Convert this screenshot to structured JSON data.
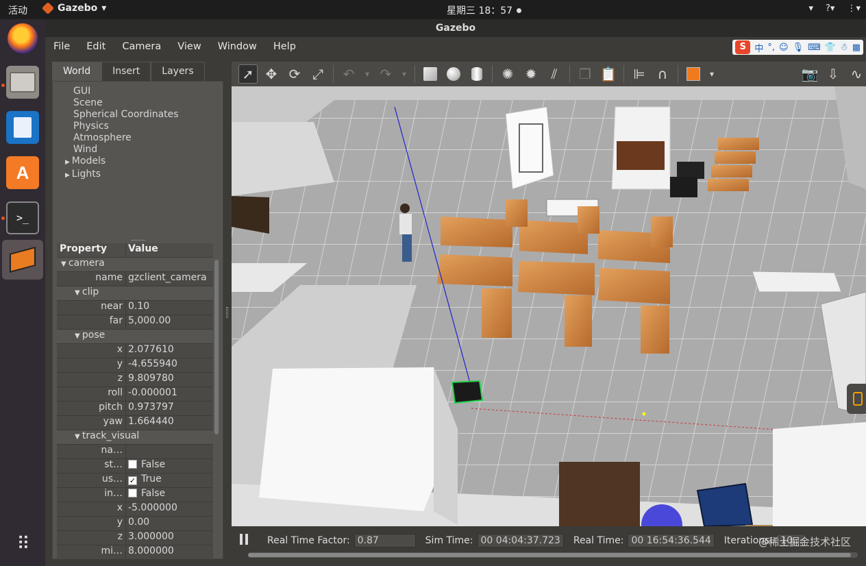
{
  "system": {
    "activities": "活动",
    "app_name": "Gazebo",
    "clock": "星期三 18：57"
  },
  "window": {
    "title": "Gazebo",
    "menu": [
      "File",
      "Edit",
      "Camera",
      "View",
      "Window",
      "Help"
    ],
    "ime": {
      "logo": "S",
      "lang": "中",
      "punct": "°,"
    }
  },
  "left_panel": {
    "tabs": [
      "World",
      "Insert",
      "Layers"
    ],
    "active_tab": "World",
    "tree": [
      "GUI",
      "Scene",
      "Spherical Coordinates",
      "Physics",
      "Atmosphere",
      "Wind",
      "Models",
      "Lights"
    ],
    "property_header": "Property",
    "value_header": "Value",
    "props": {
      "camera": "camera",
      "name_label": "name",
      "name_value": "gzclient_camera",
      "clip": "clip",
      "near_label": "near",
      "near_value": "0.10",
      "far_label": "far",
      "far_value": "5,000.00",
      "pose": "pose",
      "x_label": "x",
      "x_value": "2.077610",
      "y_label": "y",
      "y_value": "-4.655940",
      "z_label": "z",
      "z_value": "9.809780",
      "roll_label": "roll",
      "roll_value": "-0.000001",
      "pitch_label": "pitch",
      "pitch_value": "0.973797",
      "yaw_label": "yaw",
      "yaw_value": "1.664440",
      "track_visual": "track_visual",
      "na_label": "na…",
      "na_value": "",
      "st_label": "st…",
      "st_value": "False",
      "us_label": "us…",
      "us_value": "True",
      "in_label": "in…",
      "in_value": "False",
      "tx_label": "x",
      "tx_value": "-5.000000",
      "ty_label": "y",
      "ty_value": "0.00",
      "tz_label": "z",
      "tz_value": "3.000000",
      "mi_label": "mi…",
      "mi_value": "8.000000"
    }
  },
  "toolbar": {
    "tools": [
      "select",
      "translate",
      "rotate",
      "scale",
      "undo",
      "redo",
      "box",
      "sphere",
      "cylinder",
      "point-light",
      "spot-light",
      "directional-light",
      "copy",
      "paste",
      "align",
      "snap",
      "change-view",
      "screenshot",
      "log",
      "plot"
    ]
  },
  "status": {
    "rtf_label": "Real Time Factor:",
    "rtf_value": "0.87",
    "sim_label": "Sim Time:",
    "sim_value": "00 04:04:37.723",
    "real_label": "Real Time:",
    "real_value": "00 16:54:36.544",
    "iter_label": "Iterations:",
    "iter_value": "10…",
    "watermark": "@稀土掘金技术社区"
  }
}
